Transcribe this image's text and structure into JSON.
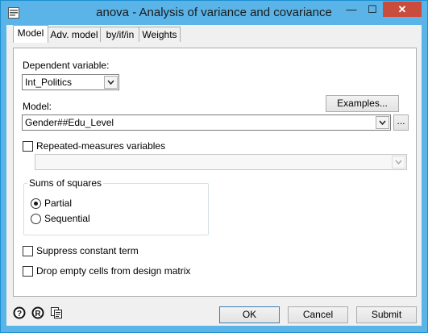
{
  "window": {
    "title": "anova - Analysis of variance and covariance",
    "controls": {
      "minimize": "—",
      "maximize": "☐",
      "close": "✕"
    }
  },
  "tabs": [
    {
      "label": "Model",
      "active": true
    },
    {
      "label": "Adv. model",
      "active": false
    },
    {
      "label": "by/if/in",
      "active": false
    },
    {
      "label": "Weights",
      "active": false
    }
  ],
  "model_tab": {
    "dependent_label": "Dependent variable:",
    "dependent_value": "Int_Politics",
    "model_label": "Model:",
    "examples_button": "Examples...",
    "model_value": "Gender##Edu_Level",
    "browse_button": "...",
    "repeated_label": "Repeated-measures variables",
    "repeated_checked": false,
    "repeated_value": "",
    "sums_group_title": "Sums of squares",
    "partial_label": "Partial",
    "partial_selected": true,
    "sequential_label": "Sequential",
    "sequential_selected": false,
    "suppress_label": "Suppress constant term",
    "suppress_checked": false,
    "drop_label": "Drop empty cells from design matrix",
    "drop_checked": false
  },
  "footer": {
    "ok_button": "OK",
    "cancel_button": "Cancel",
    "submit_button": "Submit",
    "icons": [
      "help-icon",
      "reset-icon",
      "copy-command-icon"
    ]
  },
  "colors": {
    "titlebar": "#5ab4e8",
    "close_button": "#c94c3c",
    "dialog_bg": "#f0f0f0"
  }
}
